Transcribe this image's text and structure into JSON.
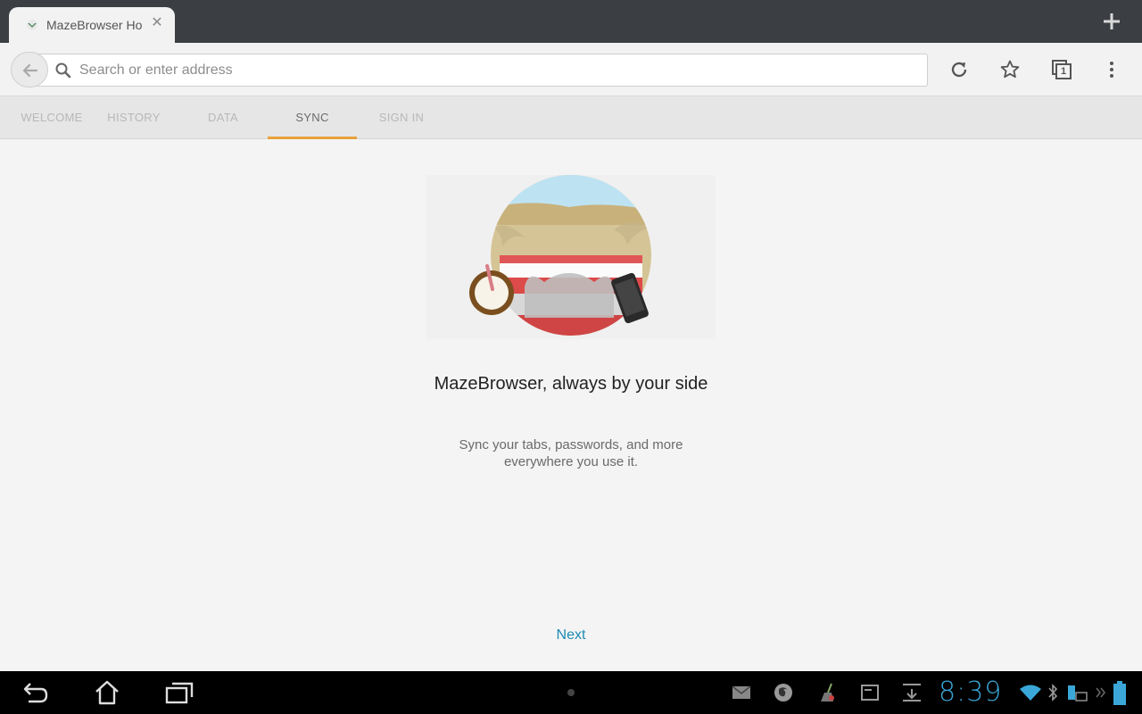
{
  "tab": {
    "title": "MazeBrowser Ho",
    "favicon": "maze-browser-logo-icon",
    "close_icon": "close-icon"
  },
  "new_tab_icon": "plus-icon",
  "toolbar": {
    "back_icon": "back-arrow-icon",
    "search_placeholder": "Search or enter address",
    "reload_icon": "reload-icon",
    "bookmark_icon": "star-icon",
    "tab_switcher_count": "1",
    "menu_icon": "overflow-menu-icon"
  },
  "nav_tabs": [
    {
      "label": "WELCOME",
      "active": false
    },
    {
      "label": "HISTORY",
      "active": false
    },
    {
      "label": "DATA",
      "active": false
    },
    {
      "label": "SYNC",
      "active": true
    },
    {
      "label": "SIGN IN",
      "active": false
    }
  ],
  "main": {
    "headline": "MazeBrowser, always by your side",
    "subtext": "Sync your tabs, passwords, and more everywhere you use it.",
    "next_label": "Next"
  },
  "system_bar": {
    "time": "8:39",
    "accent_color": "#3aa7d8"
  },
  "colors": {
    "active_tab_underline": "#e8a23a",
    "link": "#1c8bb3"
  }
}
